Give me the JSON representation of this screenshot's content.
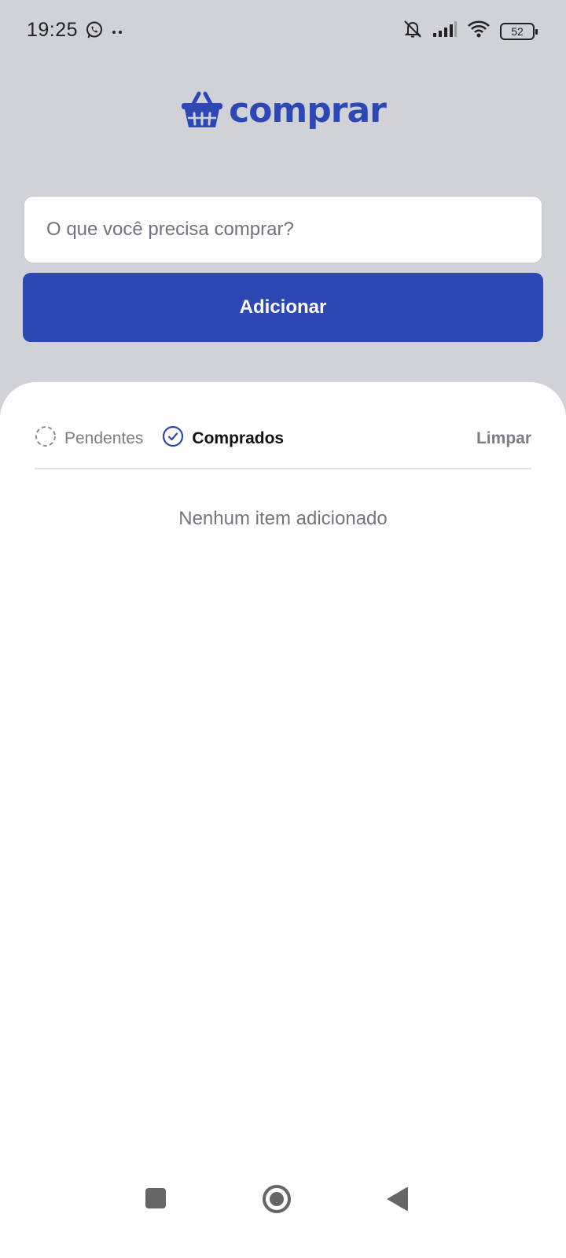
{
  "status_bar": {
    "time": "19:25",
    "battery": "52",
    "icons": [
      "whatsapp-icon",
      "more-dots-icon",
      "bell-muted-icon",
      "signal-icon",
      "wifi-icon",
      "battery-icon"
    ]
  },
  "app": {
    "logo_text": "comprar",
    "logo_icon": "basket-icon",
    "brand_color": "#2d48b5"
  },
  "form": {
    "input_placeholder": "O que você precisa comprar?",
    "input_value": "",
    "add_label": "Adicionar"
  },
  "filters": {
    "pending_label": "Pendentes",
    "bought_label": "Comprados",
    "selected": "Comprados",
    "clear_label": "Limpar"
  },
  "list": {
    "empty_message": "Nenhum item adicionado",
    "items": []
  },
  "nav_bar": {
    "buttons": [
      "recents-icon",
      "home-icon",
      "back-icon"
    ]
  }
}
